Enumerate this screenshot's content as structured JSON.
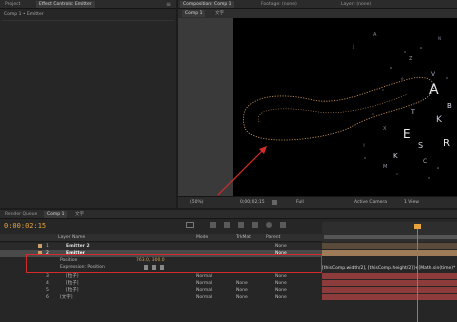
{
  "left_panel": {
    "tabs": [
      "Project",
      "Effect Controls: Emitter"
    ],
    "layer_path": "Comp 1 • Emitter"
  },
  "viewer": {
    "tabs": [
      "Composition: Comp 1",
      "Footage: (none)",
      "Layer: (none)"
    ],
    "subtabs": [
      "Comp 1",
      "文字"
    ],
    "zoom": "(50%)",
    "timecode": "0;00;02;15",
    "resolution": "Full",
    "camera": "Active Camera",
    "views": "1 View"
  },
  "timeline": {
    "tabs": [
      "Render Queue",
      "Comp 1",
      "文字"
    ],
    "timecode": "0:00:02:15",
    "columns": {
      "layer_name": "Layer Name",
      "mode": "Mode",
      "trkmat": "TrkMat",
      "parent": "Parent"
    },
    "layers": [
      {
        "num": "1",
        "name": "Emitter 2",
        "mode": "",
        "trkmat": "",
        "parent": "None"
      },
      {
        "num": "2",
        "name": "Emitter",
        "mode": "",
        "trkmat": "",
        "parent": "None"
      }
    ],
    "properties": [
      {
        "name": "Position",
        "value": "763.0, 300.0"
      },
      {
        "name": "Expression: Position",
        "value": ""
      }
    ],
    "layers_lower": [
      {
        "num": "3",
        "name": "[粒子]",
        "mode": "Normal",
        "trkmat": "",
        "parent": "None"
      },
      {
        "num": "4",
        "name": "[粒子]",
        "mode": "Normal",
        "trkmat": "None",
        "parent": "None"
      },
      {
        "num": "5",
        "name": "[粒子]",
        "mode": "Normal",
        "trkmat": "None",
        "parent": "None"
      },
      {
        "num": "6",
        "name": "[文字]",
        "mode": "Normal",
        "trkmat": "None",
        "parent": "None"
      }
    ],
    "expression": "[thisComp.width/2], [thisComp.height/2]]+[Math.sin(time)*"
  },
  "colors": {
    "accent_orange": "#e8a33a",
    "selection": "#c9a06a",
    "bar_red": "#8e3b3b",
    "highlight_red": "#d42b2b"
  }
}
